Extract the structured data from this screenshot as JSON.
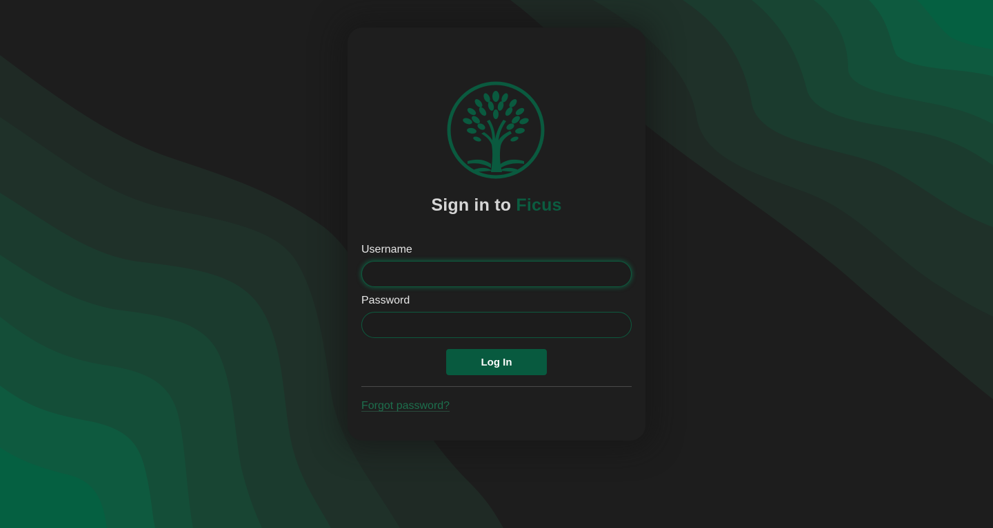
{
  "colors": {
    "background": "#1d1d1d",
    "card": "#1e1e1e",
    "accent": "#085a3f",
    "brand_text": "#0b5c40",
    "link": "#1d6f4d"
  },
  "logo": {
    "icon": "tree-of-life-icon"
  },
  "title": {
    "prefix": "Sign in to",
    "brand": "Ficus"
  },
  "form": {
    "username_label": "Username",
    "username_value": "",
    "password_label": "Password",
    "password_value": "",
    "login_label": "Log In",
    "forgot_label": "Forgot password?"
  }
}
